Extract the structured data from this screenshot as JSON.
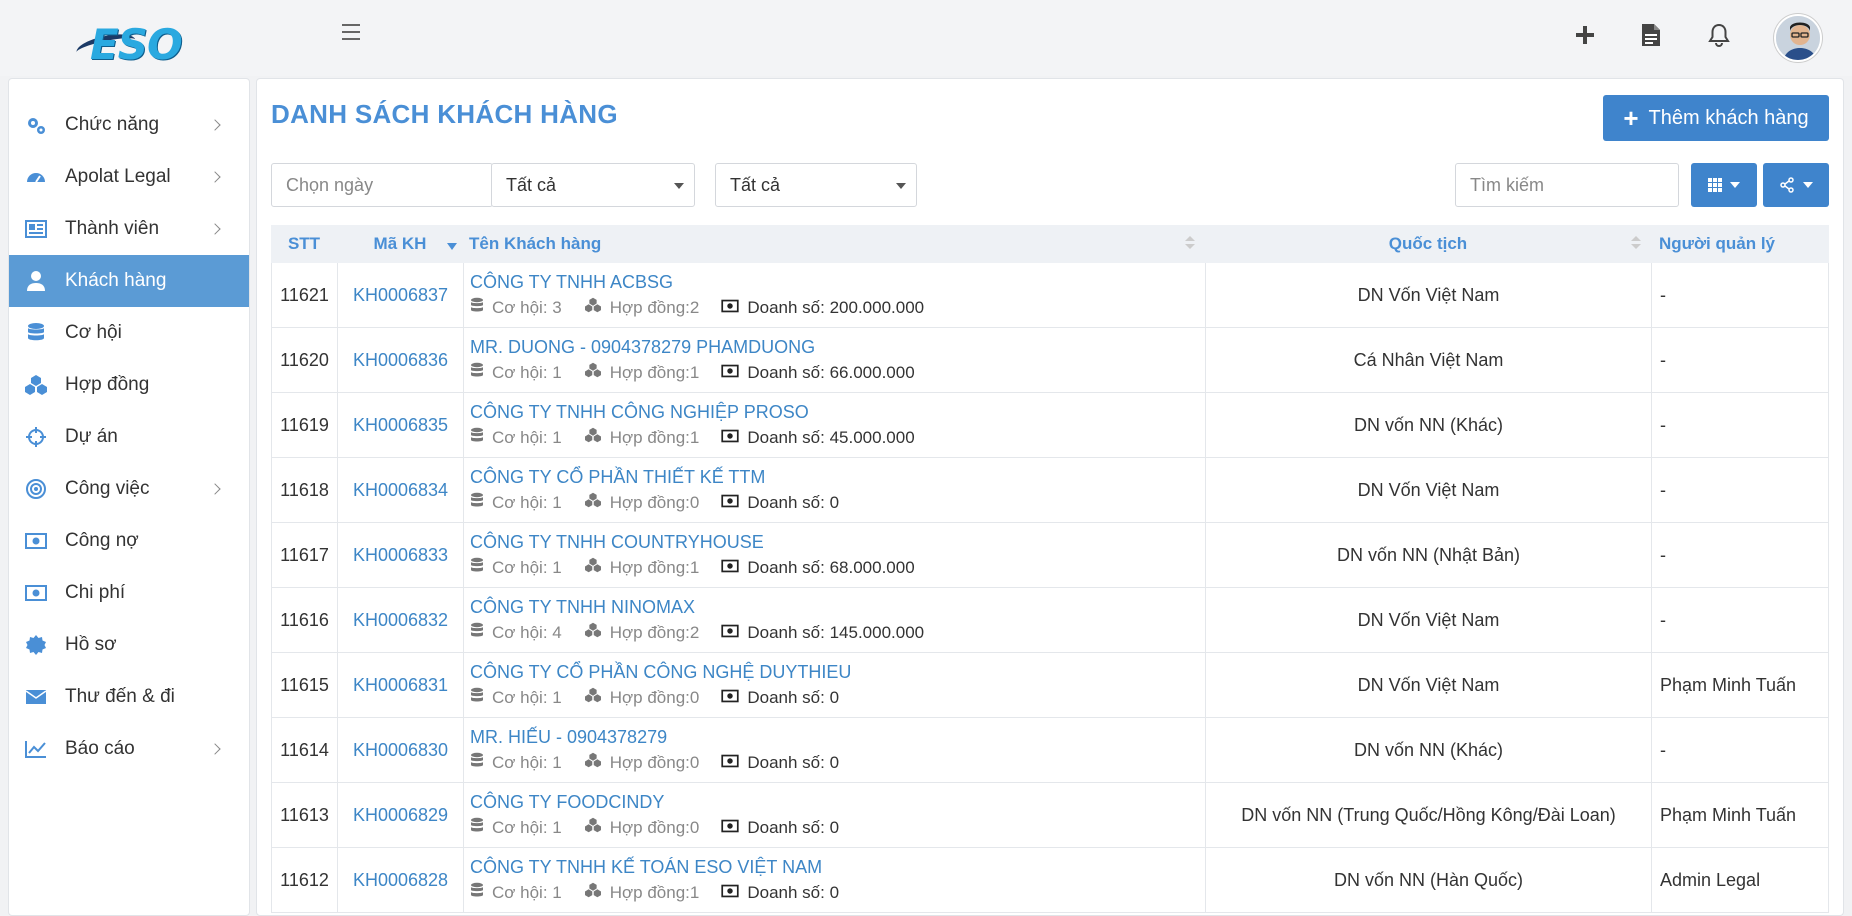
{
  "app": {
    "logo_text": "ESO"
  },
  "sidebar": {
    "items": [
      {
        "label": "Chức năng",
        "icon": "gears-icon",
        "has_children": true,
        "active": false
      },
      {
        "label": "Apolat Legal",
        "icon": "dashboard-icon",
        "has_children": true,
        "active": false
      },
      {
        "label": "Thành viên",
        "icon": "newspaper-icon",
        "has_children": true,
        "active": false
      },
      {
        "label": "Khách hàng",
        "icon": "user-icon",
        "has_children": false,
        "active": true
      },
      {
        "label": "Cơ hội",
        "icon": "database-icon",
        "has_children": false,
        "active": false
      },
      {
        "label": "Hợp đồng",
        "icon": "cubes-icon",
        "has_children": false,
        "active": false
      },
      {
        "label": "Dự án",
        "icon": "crosshairs-icon",
        "has_children": false,
        "active": false
      },
      {
        "label": "Công việc",
        "icon": "bullseye-icon",
        "has_children": true,
        "active": false
      },
      {
        "label": "Công nợ",
        "icon": "money-icon",
        "has_children": false,
        "active": false
      },
      {
        "label": "Chi phí",
        "icon": "money-icon",
        "has_children": false,
        "active": false
      },
      {
        "label": "Hồ sơ",
        "icon": "certificate-icon",
        "has_children": false,
        "active": false
      },
      {
        "label": "Thư đến & đi",
        "icon": "envelope-icon",
        "has_children": false,
        "active": false
      },
      {
        "label": "Báo cáo",
        "icon": "line-chart-icon",
        "has_children": true,
        "active": false
      }
    ]
  },
  "main": {
    "title": "DANH SÁCH KHÁCH HÀNG",
    "add_button": "Thêm khách hàng",
    "filters": {
      "date_placeholder": "Chọn ngày",
      "select1_value": "Tất cả",
      "select2_value": "Tất cả",
      "search_placeholder": "Tìm kiếm"
    },
    "table": {
      "headers": {
        "stt": "STT",
        "ma_kh": "Mã KH",
        "ten_kh": "Tên Khách hàng",
        "quoc_tich": "Quốc tịch",
        "nguoi_quan_ly": "Người quản lý"
      },
      "rows": [
        {
          "stt": "11621",
          "ma": "KH0006837",
          "name": "CÔNG TY TNHH ACBSG",
          "co_hoi": "Cơ hội: 3",
          "hop_dong": "Hợp đồng:2",
          "doanh_so": "Doanh số: 200.000.000",
          "quoc_tich": "DN Vốn Việt Nam",
          "quan_ly": "-"
        },
        {
          "stt": "11620",
          "ma": "KH0006836",
          "name": "MR. DUONG - 0904378279 PHAMDUONG",
          "co_hoi": "Cơ hội: 1",
          "hop_dong": "Hợp đồng:1",
          "doanh_so": "Doanh số: 66.000.000",
          "quoc_tich": "Cá Nhân Việt Nam",
          "quan_ly": "-"
        },
        {
          "stt": "11619",
          "ma": "KH0006835",
          "name": "CÔNG TY TNHH CÔNG NGHIỆP PROSO",
          "co_hoi": "Cơ hội: 1",
          "hop_dong": "Hợp đồng:1",
          "doanh_so": "Doanh số: 45.000.000",
          "quoc_tich": "DN vốn NN (Khác)",
          "quan_ly": "-"
        },
        {
          "stt": "11618",
          "ma": "KH0006834",
          "name": "CÔNG TY CỔ PHẦN THIẾT KẾ TTM",
          "co_hoi": "Cơ hội: 1",
          "hop_dong": "Hợp đồng:0",
          "doanh_so": "Doanh số: 0",
          "quoc_tich": "DN Vốn Việt Nam",
          "quan_ly": "-"
        },
        {
          "stt": "11617",
          "ma": "KH0006833",
          "name": "CÔNG TY TNHH COUNTRYHOUSE",
          "co_hoi": "Cơ hội: 1",
          "hop_dong": "Hợp đồng:1",
          "doanh_so": "Doanh số: 68.000.000",
          "quoc_tich": "DN vốn NN (Nhật Bản)",
          "quan_ly": "-"
        },
        {
          "stt": "11616",
          "ma": "KH0006832",
          "name": "CÔNG TY TNHH NINOMAX",
          "co_hoi": "Cơ hội: 4",
          "hop_dong": "Hợp đồng:2",
          "doanh_so": "Doanh số: 145.000.000",
          "quoc_tich": "DN Vốn Việt Nam",
          "quan_ly": "-"
        },
        {
          "stt": "11615",
          "ma": "KH0006831",
          "name": "CÔNG TY CỔ PHẦN CÔNG NGHỆ DUYTHIEU",
          "co_hoi": "Cơ hội: 1",
          "hop_dong": "Hợp đồng:0",
          "doanh_so": "Doanh số: 0",
          "quoc_tich": "DN Vốn Việt Nam",
          "quan_ly": "Phạm Minh Tuấn"
        },
        {
          "stt": "11614",
          "ma": "KH0006830",
          "name": "MR. HIẾU - 0904378279",
          "co_hoi": "Cơ hội: 1",
          "hop_dong": "Hợp đồng:0",
          "doanh_so": "Doanh số: 0",
          "quoc_tich": "DN vốn NN (Khác)",
          "quan_ly": "-"
        },
        {
          "stt": "11613",
          "ma": "KH0006829",
          "name": "CÔNG TY FOODCINDY",
          "co_hoi": "Cơ hội: 1",
          "hop_dong": "Hợp đồng:0",
          "doanh_so": "Doanh số: 0",
          "quoc_tich": "DN vốn NN (Trung Quốc/Hồng Kông/Đài Loan)",
          "quan_ly": "Phạm Minh Tuấn"
        },
        {
          "stt": "11612",
          "ma": "KH0006828",
          "name": "CÔNG TY TNHH KẾ TOÁN ESO VIỆT NAM",
          "co_hoi": "Cơ hội: 1",
          "hop_dong": "Hợp đồng:1",
          "doanh_so": "Doanh số: 0",
          "quoc_tich": "DN vốn NN (Hàn Quốc)",
          "quan_ly": "Admin Legal"
        }
      ]
    }
  },
  "colors": {
    "accent": "#3f84cc",
    "link": "#3d86c6",
    "title": "#4a8fd6",
    "active_nav": "#5b9bd5"
  }
}
